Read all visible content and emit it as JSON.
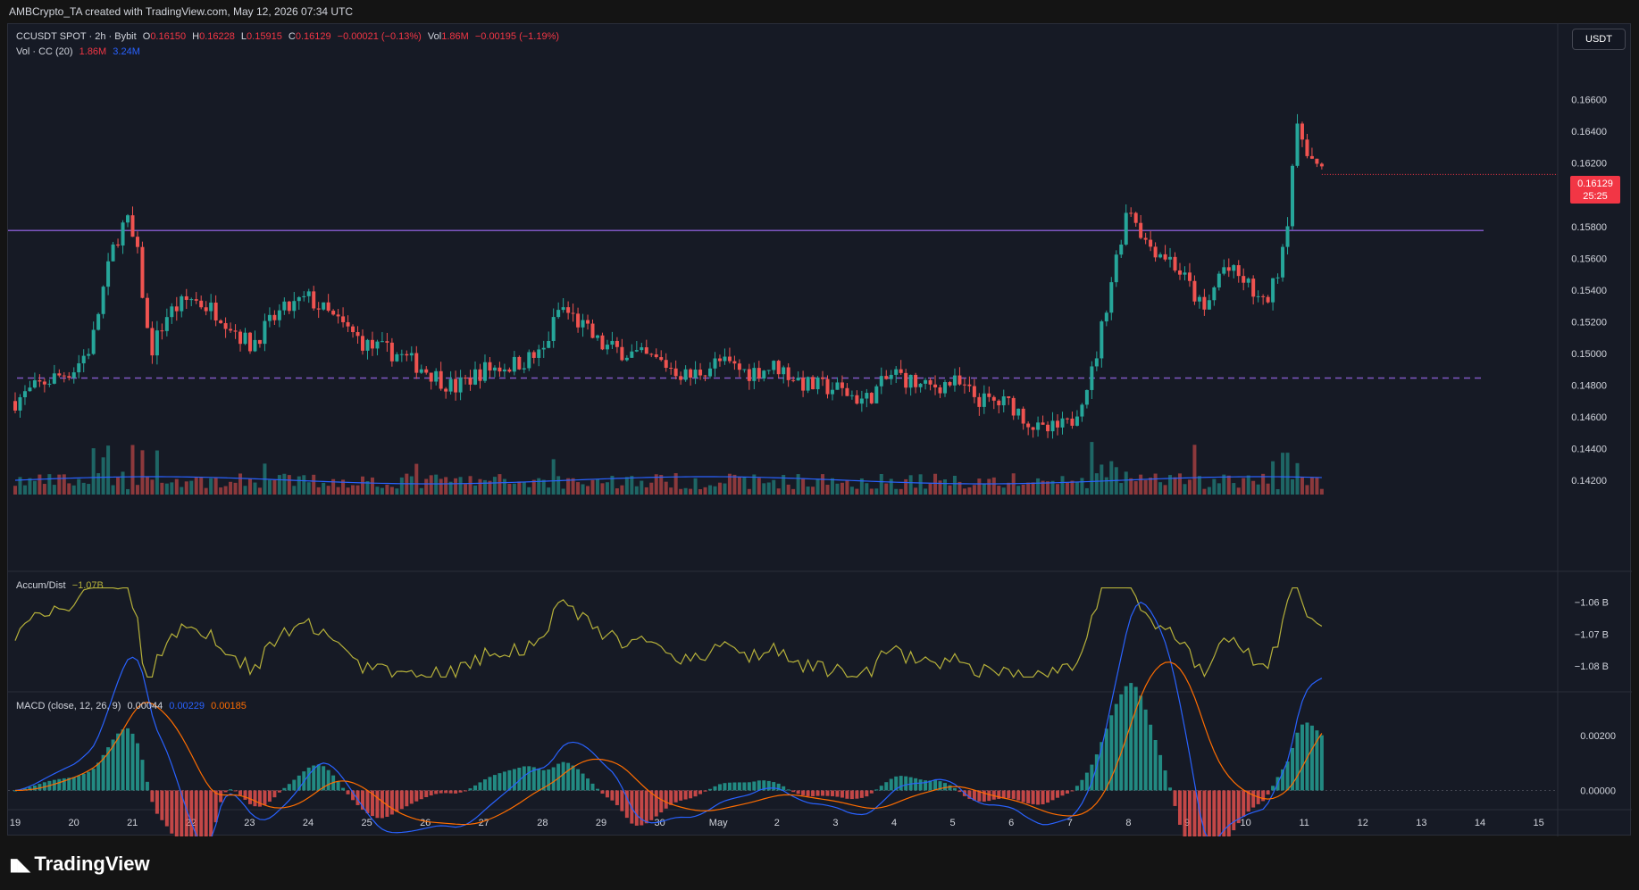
{
  "header": {
    "credit": "AMBCrypto_TA created with TradingView.com, May 12, 2026 07:34 UTC"
  },
  "legend": {
    "symbol": "CCUSDT SPOT · 2h · Bybit",
    "o_label": "O",
    "o": "0.16150",
    "h_label": "H",
    "h": "0.16228",
    "l_label": "L",
    "l": "0.15915",
    "c_label": "C",
    "c": "0.16129",
    "change": "−0.00021 (−0.13%)",
    "vol_label": "Vol",
    "vol": "1.86M",
    "vol_change": "−0.00195 (−1.19%)",
    "volume_indicator": "Vol · CC (20)",
    "volume_value": "1.86M",
    "volume_ma": "3.24M",
    "accum_label": "Accum/Dist",
    "accum_value": "−1.07B",
    "macd_label": "MACD (close, 12, 26, 9)",
    "macd_hist": "0.00044",
    "macd_line": "0.00229",
    "macd_signal": "0.00185"
  },
  "currency_button": "USDT",
  "price_tag": {
    "price": "0.16129",
    "countdown": "25:25"
  },
  "logo": {
    "text": "TradingView"
  },
  "colors": {
    "background": "#161a25",
    "up": "#26a69a",
    "down": "#ef5350",
    "resistance": "#7e57c2",
    "macd": "#2962ff",
    "signal": "#ff6d00",
    "accum": "#b5b03a"
  },
  "chart_data": {
    "type": "candlestick",
    "symbol": "CCUSDT SPOT",
    "interval": "2h",
    "exchange": "Bybit",
    "price_axis": {
      "ticks": [
        "0.16600",
        "0.16400",
        "0.16200",
        "0.16000",
        "0.15800",
        "0.15600",
        "0.15400",
        "0.15200",
        "0.15000",
        "0.14800",
        "0.14600",
        "0.14400",
        "0.14200"
      ],
      "range": [
        0.1415,
        0.1675
      ]
    },
    "x_axis": {
      "ticks": [
        "19",
        "20",
        "21",
        "22",
        "23",
        "24",
        "25",
        "26",
        "27",
        "28",
        "29",
        "30",
        "May",
        "2",
        "3",
        "4",
        "5",
        "6",
        "7",
        "8",
        "9",
        "10",
        "11",
        "12",
        "13",
        "14",
        "15"
      ]
    },
    "levels": {
      "resistance": 0.15775,
      "support": 0.14845
    },
    "price_path": [
      {
        "day": 0.0,
        "price": 0.147
      },
      {
        "day": 0.5,
        "price": 0.1482
      },
      {
        "day": 1.0,
        "price": 0.149
      },
      {
        "day": 1.3,
        "price": 0.1505
      },
      {
        "day": 1.5,
        "price": 0.154
      },
      {
        "day": 1.7,
        "price": 0.157
      },
      {
        "day": 1.9,
        "price": 0.1585
      },
      {
        "day": 2.1,
        "price": 0.156
      },
      {
        "day": 2.3,
        "price": 0.15
      },
      {
        "day": 2.6,
        "price": 0.1525
      },
      {
        "day": 3.0,
        "price": 0.1535
      },
      {
        "day": 3.5,
        "price": 0.1525
      },
      {
        "day": 4.0,
        "price": 0.1505
      },
      {
        "day": 4.5,
        "price": 0.1525
      },
      {
        "day": 5.0,
        "price": 0.1535
      },
      {
        "day": 5.5,
        "price": 0.152
      },
      {
        "day": 6.0,
        "price": 0.1505
      },
      {
        "day": 6.5,
        "price": 0.15
      },
      {
        "day": 7.0,
        "price": 0.149
      },
      {
        "day": 7.5,
        "price": 0.1478
      },
      {
        "day": 8.0,
        "price": 0.149
      },
      {
        "day": 8.5,
        "price": 0.1493
      },
      {
        "day": 9.0,
        "price": 0.15
      },
      {
        "day": 9.3,
        "price": 0.153
      },
      {
        "day": 9.6,
        "price": 0.152
      },
      {
        "day": 10.0,
        "price": 0.1505
      },
      {
        "day": 10.5,
        "price": 0.15
      },
      {
        "day": 11.0,
        "price": 0.1495
      },
      {
        "day": 11.5,
        "price": 0.1485
      },
      {
        "day": 12.0,
        "price": 0.1495
      },
      {
        "day": 12.5,
        "price": 0.1488
      },
      {
        "day": 13.0,
        "price": 0.1492
      },
      {
        "day": 13.5,
        "price": 0.148
      },
      {
        "day": 14.0,
        "price": 0.1478
      },
      {
        "day": 14.5,
        "price": 0.147
      },
      {
        "day": 15.0,
        "price": 0.1488
      },
      {
        "day": 15.5,
        "price": 0.1478
      },
      {
        "day": 16.0,
        "price": 0.1482
      },
      {
        "day": 16.5,
        "price": 0.147
      },
      {
        "day": 17.0,
        "price": 0.1468
      },
      {
        "day": 17.5,
        "price": 0.145
      },
      {
        "day": 18.0,
        "price": 0.1455
      },
      {
        "day": 18.4,
        "price": 0.149
      },
      {
        "day": 18.7,
        "price": 0.1545
      },
      {
        "day": 19.0,
        "price": 0.1595
      },
      {
        "day": 19.3,
        "price": 0.157
      },
      {
        "day": 19.7,
        "price": 0.156
      },
      {
        "day": 20.0,
        "price": 0.1545
      },
      {
        "day": 20.3,
        "price": 0.1525
      },
      {
        "day": 20.6,
        "price": 0.1555
      },
      {
        "day": 21.0,
        "price": 0.1545
      },
      {
        "day": 21.3,
        "price": 0.153
      },
      {
        "day": 21.5,
        "price": 0.1545
      },
      {
        "day": 21.7,
        "price": 0.158
      },
      {
        "day": 21.85,
        "price": 0.164
      },
      {
        "day": 22.0,
        "price": 0.1635
      },
      {
        "day": 22.15,
        "price": 0.162
      },
      {
        "day": 22.3,
        "price": 0.1613
      }
    ],
    "accum_dist": {
      "ticks": [
        "−1.06 B",
        "−1.07 B",
        "−1.08 B"
      ],
      "range": [
        -1.0845,
        -1.0545
      ],
      "last": "−1.07B"
    },
    "macd": {
      "params": "close, 12, 26, 9",
      "ticks": [
        "0.00200",
        "0.00000"
      ],
      "range": [
        -0.0007,
        0.0032
      ],
      "histogram": "0.00044",
      "macd": "0.00229",
      "signal": "0.00185"
    }
  }
}
